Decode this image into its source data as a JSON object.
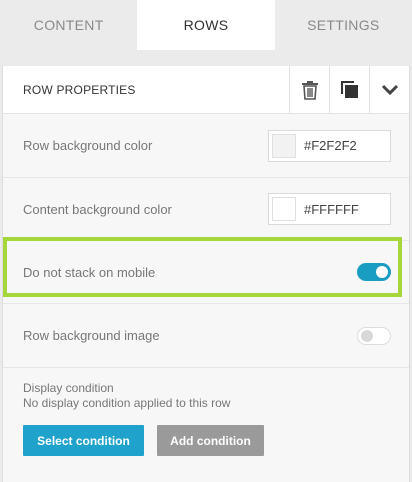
{
  "tabs": [
    {
      "label": "CONTENT",
      "active": false
    },
    {
      "label": "ROWS",
      "active": true
    },
    {
      "label": "SETTINGS",
      "active": false
    }
  ],
  "panel": {
    "title": "ROW PROPERTIES",
    "icons": [
      "trash-icon",
      "duplicate-icon",
      "chevron-down-icon"
    ]
  },
  "row_bg": {
    "label": "Row background color",
    "value": "#F2F2F2",
    "swatch": "#F2F2F2"
  },
  "content_bg": {
    "label": "Content background color",
    "value": "#FFFFFF",
    "swatch": "#FFFFFF"
  },
  "stack": {
    "label": "Do not stack on mobile",
    "enabled": true
  },
  "bg_image": {
    "label": "Row background image",
    "enabled": false
  },
  "condition": {
    "title": "Display condition",
    "description": "No display condition applied to this row",
    "select_label": "Select condition",
    "add_label": "Add condition"
  },
  "colors": {
    "accent": "#1FA2CB",
    "highlight": "#A5D63A",
    "secondary_button": "#9A9A9A"
  }
}
